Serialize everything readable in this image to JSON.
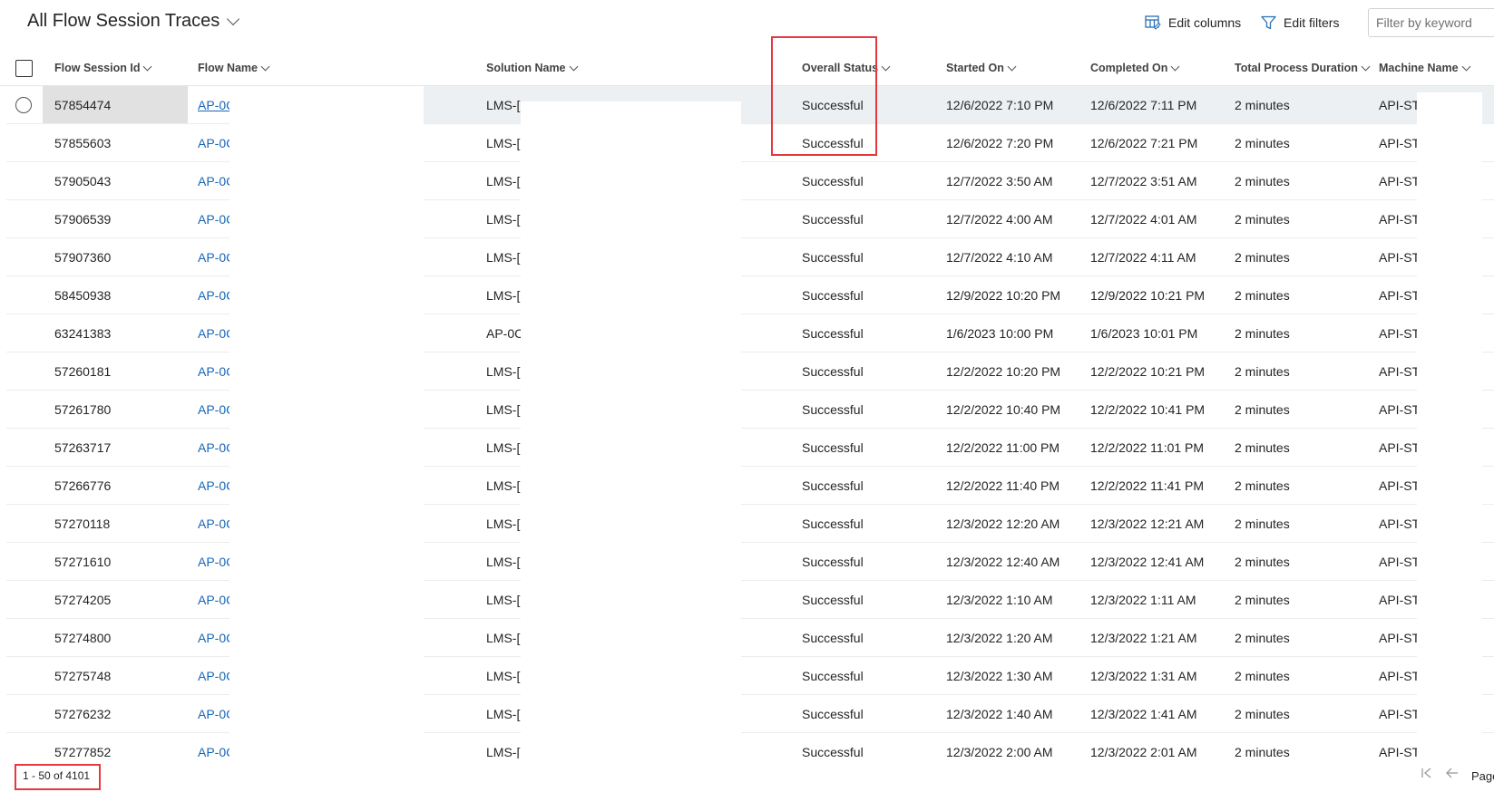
{
  "view": {
    "title": "All Flow Session Traces"
  },
  "toolbar": {
    "edit_columns": "Edit columns",
    "edit_filters": "Edit filters",
    "filter_placeholder": "Filter by keyword"
  },
  "columns": [
    "Flow Session Id",
    "Flow Name",
    "Solution Name",
    "Overall Status",
    "Started On",
    "Completed On",
    "Total Process Duration",
    "Machine Name"
  ],
  "rows": [
    {
      "id": "57854474",
      "flow": "AP-0C",
      "solution": "LMS-[",
      "status": "Successful",
      "started": "12/6/2022 7:10 PM",
      "completed": "12/6/2022 7:11 PM",
      "duration": "2 minutes",
      "machine": "API-ST"
    },
    {
      "id": "57855603",
      "flow": "AP-0C",
      "solution": "LMS-[",
      "status": "Successful",
      "started": "12/6/2022 7:20 PM",
      "completed": "12/6/2022 7:21 PM",
      "duration": "2 minutes",
      "machine": "API-ST"
    },
    {
      "id": "57905043",
      "flow": "AP-0C",
      "solution": "LMS-[",
      "status": "Successful",
      "started": "12/7/2022 3:50 AM",
      "completed": "12/7/2022 3:51 AM",
      "duration": "2 minutes",
      "machine": "API-ST"
    },
    {
      "id": "57906539",
      "flow": "AP-0C",
      "solution": "LMS-[",
      "status": "Successful",
      "started": "12/7/2022 4:00 AM",
      "completed": "12/7/2022 4:01 AM",
      "duration": "2 minutes",
      "machine": "API-ST"
    },
    {
      "id": "57907360",
      "flow": "AP-0C",
      "solution": "LMS-[",
      "status": "Successful",
      "started": "12/7/2022 4:10 AM",
      "completed": "12/7/2022 4:11 AM",
      "duration": "2 minutes",
      "machine": "API-ST"
    },
    {
      "id": "58450938",
      "flow": "AP-0C",
      "solution": "LMS-[",
      "status": "Successful",
      "started": "12/9/2022 10:20 PM",
      "completed": "12/9/2022 10:21 PM",
      "duration": "2 minutes",
      "machine": "API-ST"
    },
    {
      "id": "63241383",
      "flow": "AP-0C",
      "solution": "AP-0C",
      "status": "Successful",
      "started": "1/6/2023 10:00 PM",
      "completed": "1/6/2023 10:01 PM",
      "duration": "2 minutes",
      "machine": "API-ST"
    },
    {
      "id": "57260181",
      "flow": "AP-0C",
      "solution": "LMS-[",
      "status": "Successful",
      "started": "12/2/2022 10:20 PM",
      "completed": "12/2/2022 10:21 PM",
      "duration": "2 minutes",
      "machine": "API-ST"
    },
    {
      "id": "57261780",
      "flow": "AP-0C",
      "solution": "LMS-[",
      "status": "Successful",
      "started": "12/2/2022 10:40 PM",
      "completed": "12/2/2022 10:41 PM",
      "duration": "2 minutes",
      "machine": "API-ST"
    },
    {
      "id": "57263717",
      "flow": "AP-0C",
      "solution": "LMS-[",
      "status": "Successful",
      "started": "12/2/2022 11:00 PM",
      "completed": "12/2/2022 11:01 PM",
      "duration": "2 minutes",
      "machine": "API-ST"
    },
    {
      "id": "57266776",
      "flow": "AP-0C",
      "solution": "LMS-[",
      "status": "Successful",
      "started": "12/2/2022 11:40 PM",
      "completed": "12/2/2022 11:41 PM",
      "duration": "2 minutes",
      "machine": "API-ST"
    },
    {
      "id": "57270118",
      "flow": "AP-0C",
      "solution": "LMS-[",
      "status": "Successful",
      "started": "12/3/2022 12:20 AM",
      "completed": "12/3/2022 12:21 AM",
      "duration": "2 minutes",
      "machine": "API-ST"
    },
    {
      "id": "57271610",
      "flow": "AP-0C",
      "solution": "LMS-[",
      "status": "Successful",
      "started": "12/3/2022 12:40 AM",
      "completed": "12/3/2022 12:41 AM",
      "duration": "2 minutes",
      "machine": "API-ST"
    },
    {
      "id": "57274205",
      "flow": "AP-0C",
      "solution": "LMS-[",
      "status": "Successful",
      "started": "12/3/2022 1:10 AM",
      "completed": "12/3/2022 1:11 AM",
      "duration": "2 minutes",
      "machine": "API-ST"
    },
    {
      "id": "57274800",
      "flow": "AP-0C",
      "solution": "LMS-[",
      "status": "Successful",
      "started": "12/3/2022 1:20 AM",
      "completed": "12/3/2022 1:21 AM",
      "duration": "2 minutes",
      "machine": "API-ST"
    },
    {
      "id": "57275748",
      "flow": "AP-0C",
      "solution": "LMS-[",
      "status": "Successful",
      "started": "12/3/2022 1:30 AM",
      "completed": "12/3/2022 1:31 AM",
      "duration": "2 minutes",
      "machine": "API-ST"
    },
    {
      "id": "57276232",
      "flow": "AP-0C",
      "solution": "LMS-[",
      "status": "Successful",
      "started": "12/3/2022 1:40 AM",
      "completed": "12/3/2022 1:41 AM",
      "duration": "2 minutes",
      "machine": "API-ST"
    },
    {
      "id": "57277852",
      "flow": "AP-0C",
      "solution": "LMS-[",
      "status": "Successful",
      "started": "12/3/2022 2:00 AM",
      "completed": "12/3/2022 2:01 AM",
      "duration": "2 minutes",
      "machine": "API-ST"
    }
  ],
  "footer": {
    "count": "1 - 50 of 4101",
    "page_label": "Page"
  },
  "colors": {
    "link": "#1766b8",
    "annotation": "#e5383f",
    "selected_row": "#edf0f2"
  }
}
